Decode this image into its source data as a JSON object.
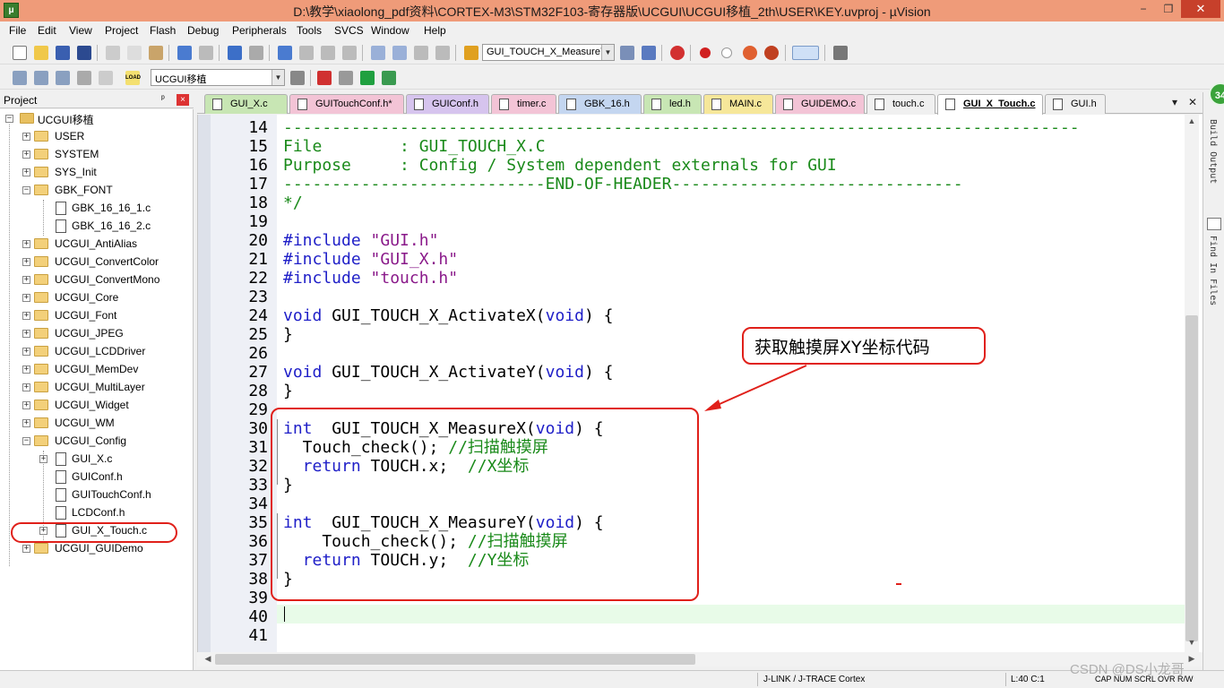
{
  "window": {
    "title": "D:\\教学\\xiaolong_pdf资料\\CORTEX-M3\\STM32F103-寄存器版\\UCGUI\\UCGUI移植_2th\\USER\\KEY.uvproj - µVision",
    "icon_label": "μ",
    "min_label": "−",
    "max_label": "❐",
    "close_label": "✕"
  },
  "menu": [
    "File",
    "Edit",
    "View",
    "Project",
    "Flash",
    "Debug",
    "Peripherals",
    "Tools",
    "SVCS",
    "Window",
    "Help"
  ],
  "toolbar": {
    "function_combo": "GUI_TOUCH_X_MeasureY",
    "target_combo": "UCGUI移植",
    "load_label": "LOAD"
  },
  "project": {
    "title": "Project",
    "pin_label": "ᵖ",
    "close_label": "×",
    "root": "UCGUI移植",
    "groups": [
      {
        "label": "USER",
        "expanded": false
      },
      {
        "label": "SYSTEM",
        "expanded": false
      },
      {
        "label": "SYS_Init",
        "expanded": false
      },
      {
        "label": "GBK_FONT",
        "expanded": true,
        "files": [
          "GBK_16_16_1.c",
          "GBK_16_16_2.c"
        ]
      },
      {
        "label": "UCGUI_AntiAlias",
        "expanded": false
      },
      {
        "label": "UCGUI_ConvertColor",
        "expanded": false
      },
      {
        "label": "UCGUI_ConvertMono",
        "expanded": false
      },
      {
        "label": "UCGUI_Core",
        "expanded": false
      },
      {
        "label": "UCGUI_Font",
        "expanded": false
      },
      {
        "label": "UCGUI_JPEG",
        "expanded": false
      },
      {
        "label": "UCGUI_LCDDriver",
        "expanded": false
      },
      {
        "label": "UCGUI_MemDev",
        "expanded": false
      },
      {
        "label": "UCGUI_MultiLayer",
        "expanded": false
      },
      {
        "label": "UCGUI_Widget",
        "expanded": false
      },
      {
        "label": "UCGUI_WM",
        "expanded": false
      },
      {
        "label": "UCGUI_Config",
        "expanded": true,
        "files": [
          "GUI_X.c",
          "GUIConf.h",
          "GUITouchConf.h",
          "LCDConf.h",
          "GUI_X_Touch.c"
        ]
      },
      {
        "label": "UCGUI_GUIDemo",
        "expanded": false
      }
    ]
  },
  "tabs": [
    {
      "label": "GUI_X.c",
      "color": "#c8e6b4",
      "active": false
    },
    {
      "label": "GUITouchConf.h*",
      "color": "#f3c4d6",
      "active": false
    },
    {
      "label": "GUIConf.h",
      "color": "#d6c4ee",
      "active": false
    },
    {
      "label": "timer.c",
      "color": "#f3c4d6",
      "active": false
    },
    {
      "label": "GBK_16.h",
      "color": "#c4d6f0",
      "active": false
    },
    {
      "label": "led.h",
      "color": "#c8e6b4",
      "active": false
    },
    {
      "label": "MAIN.c",
      "color": "#f6e79a",
      "active": false
    },
    {
      "label": "GUIDEMO.c",
      "color": "#f3c4d6",
      "active": false
    },
    {
      "label": "touch.c",
      "color": "#f0f0f0",
      "active": false
    },
    {
      "label": "GUI_X_Touch.c",
      "color": "#ffffff",
      "active": true
    },
    {
      "label": "GUI.h",
      "color": "#f0f0f0",
      "active": false
    }
  ],
  "tab_controls": {
    "dropdown": "▾",
    "close": "✕"
  },
  "editor": {
    "lines": [
      {
        "no": "14",
        "parts": [
          {
            "t": "----------------------------------------------------------------------------------",
            "c": "green"
          }
        ]
      },
      {
        "no": "15",
        "parts": [
          {
            "t": "File        : GUI_TOUCH_X.C",
            "c": "green"
          }
        ]
      },
      {
        "no": "16",
        "parts": [
          {
            "t": "Purpose     : Config / System dependent externals for GUI",
            "c": "green"
          }
        ]
      },
      {
        "no": "17",
        "parts": [
          {
            "t": "---------------------------END-OF-HEADER------------------------------",
            "c": "green"
          }
        ]
      },
      {
        "no": "18",
        "parts": [
          {
            "t": "*/",
            "c": "green"
          }
        ]
      },
      {
        "no": "19",
        "parts": []
      },
      {
        "no": "20",
        "parts": [
          {
            "t": "#include ",
            "c": "blue"
          },
          {
            "t": "\"GUI.h\"",
            "c": "purple"
          }
        ]
      },
      {
        "no": "21",
        "parts": [
          {
            "t": "#include ",
            "c": "blue"
          },
          {
            "t": "\"GUI_X.h\"",
            "c": "purple"
          }
        ]
      },
      {
        "no": "22",
        "parts": [
          {
            "t": "#include ",
            "c": "blue"
          },
          {
            "t": "\"touch.h\"",
            "c": "purple"
          }
        ]
      },
      {
        "no": "23",
        "parts": []
      },
      {
        "no": "24",
        "parts": [
          {
            "t": "void",
            "c": "blue"
          },
          {
            "t": " GUI_TOUCH_X_ActivateX(",
            "c": "black"
          },
          {
            "t": "void",
            "c": "blue"
          },
          {
            "t": ") {",
            "c": "black"
          }
        ]
      },
      {
        "no": "25",
        "parts": [
          {
            "t": "}",
            "c": "black"
          }
        ]
      },
      {
        "no": "26",
        "parts": []
      },
      {
        "no": "27",
        "parts": [
          {
            "t": "void",
            "c": "blue"
          },
          {
            "t": " GUI_TOUCH_X_ActivateY(",
            "c": "black"
          },
          {
            "t": "void",
            "c": "blue"
          },
          {
            "t": ") {",
            "c": "black"
          }
        ]
      },
      {
        "no": "28",
        "parts": [
          {
            "t": "}",
            "c": "black"
          }
        ]
      },
      {
        "no": "29",
        "parts": []
      },
      {
        "no": "30",
        "parts": [
          {
            "t": "int",
            "c": "blue"
          },
          {
            "t": "  GUI_TOUCH_X_MeasureX(",
            "c": "black"
          },
          {
            "t": "void",
            "c": "blue"
          },
          {
            "t": ") {",
            "c": "black"
          }
        ]
      },
      {
        "no": "31",
        "parts": [
          {
            "t": "  Touch_check(); ",
            "c": "black"
          },
          {
            "t": "//扫描触摸屏",
            "c": "green"
          }
        ]
      },
      {
        "no": "32",
        "parts": [
          {
            "t": "  return",
            "c": "blue"
          },
          {
            "t": " TOUCH.x;  ",
            "c": "black"
          },
          {
            "t": "//X坐标",
            "c": "green"
          }
        ]
      },
      {
        "no": "33",
        "parts": [
          {
            "t": "}",
            "c": "black"
          }
        ]
      },
      {
        "no": "34",
        "parts": []
      },
      {
        "no": "35",
        "parts": [
          {
            "t": "int",
            "c": "blue"
          },
          {
            "t": "  GUI_TOUCH_X_MeasureY(",
            "c": "black"
          },
          {
            "t": "void",
            "c": "blue"
          },
          {
            "t": ") {",
            "c": "black"
          }
        ]
      },
      {
        "no": "36",
        "parts": [
          {
            "t": "    Touch_check(); ",
            "c": "black"
          },
          {
            "t": "//扫描触摸屏",
            "c": "green"
          }
        ]
      },
      {
        "no": "37",
        "parts": [
          {
            "t": "  return",
            "c": "blue"
          },
          {
            "t": " TOUCH.y;  ",
            "c": "black"
          },
          {
            "t": "//Y坐标",
            "c": "green"
          }
        ]
      },
      {
        "no": "38",
        "parts": [
          {
            "t": "}",
            "c": "black"
          }
        ]
      },
      {
        "no": "39",
        "parts": []
      },
      {
        "no": "40",
        "parts": []
      },
      {
        "no": "41",
        "parts": []
      }
    ],
    "current_line": "40"
  },
  "side_panels": {
    "build_output": "Build Output",
    "find_in_files": "Find In Files",
    "badge": "34"
  },
  "status": {
    "debugger": "J-LINK / J-TRACE Cortex",
    "position": "L:40 C:1",
    "flags": "CAP  NUM  SCRL  OVR  R/W"
  },
  "annotation": {
    "callout": "获取触摸屏XY坐标代码"
  },
  "watermark": "CSDN @DS小龙哥",
  "colors": {
    "titlebar": "#ef9b79",
    "comment": "#1a8a1a",
    "keyword": "#2020c8",
    "string": "#8a1a8a",
    "annotation_red": "#e0201a",
    "current_line": "#e8fbe8"
  }
}
